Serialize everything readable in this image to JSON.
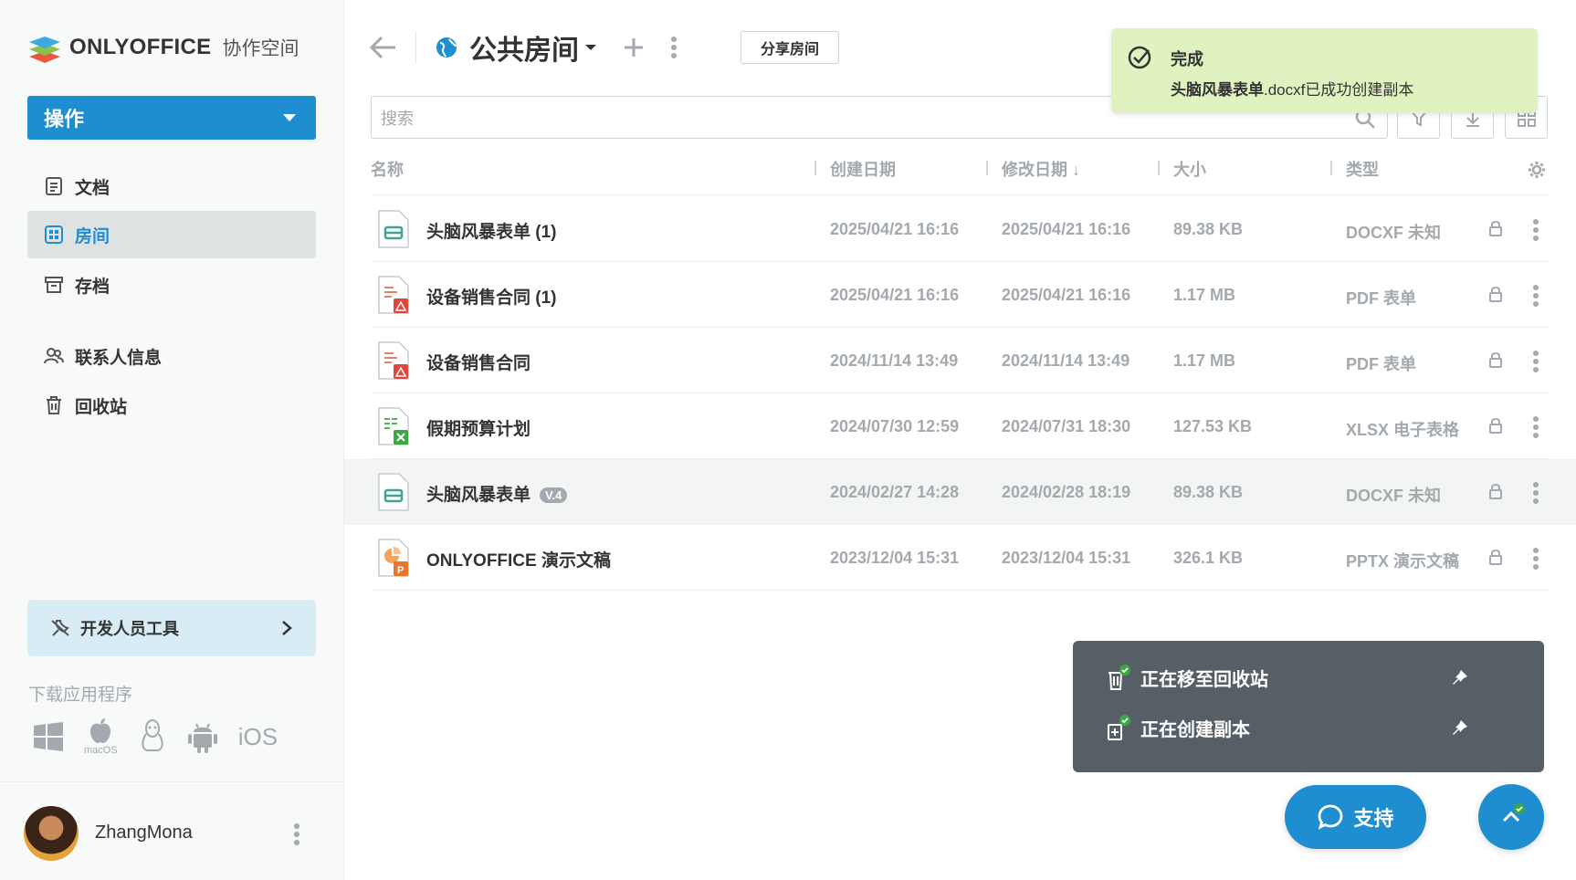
{
  "sidebar": {
    "logo_text": "ONLYOFFICE",
    "logo_sub": "协作空间",
    "action_label": "操作",
    "nav": [
      {
        "label": "文档",
        "icon": "document-icon"
      },
      {
        "label": "房间",
        "icon": "rooms-icon",
        "active": true
      },
      {
        "label": "存档",
        "icon": "archive-icon"
      },
      {
        "label": "联系人信息",
        "icon": "contacts-icon"
      },
      {
        "label": "回收站",
        "icon": "trash-icon"
      }
    ],
    "dev_tools_label": "开发人员工具",
    "download_label": "下载应用程序",
    "apps": [
      "windows-icon",
      "macos-icon",
      "linux-icon",
      "android-icon",
      "ios-icon"
    ],
    "apps_macos_caption": "macOS",
    "apps_ios_label": "iOS",
    "username": "ZhangMona"
  },
  "header": {
    "room_title": "公共房间",
    "share_label": "分享房间",
    "search_placeholder": "搜索"
  },
  "table": {
    "columns": [
      "名称",
      "创建日期",
      "修改日期",
      "大小",
      "类型"
    ],
    "sort_arrow": "↓",
    "rows": [
      {
        "name": "头脑风暴表单 (1)",
        "created": "2025/04/21 16:16",
        "modified": "2025/04/21 16:16",
        "size": "89.38 KB",
        "type": "DOCXF 未知",
        "icon": "docxf-icon"
      },
      {
        "name": "设备销售合同 (1)",
        "created": "2025/04/21 16:16",
        "modified": "2025/04/21 16:16",
        "size": "1.17 MB",
        "type": "PDF 表单",
        "icon": "pdf-icon"
      },
      {
        "name": "设备销售合同",
        "created": "2024/11/14 13:49",
        "modified": "2024/11/14 13:49",
        "size": "1.17 MB",
        "type": "PDF 表单",
        "icon": "pdf-icon"
      },
      {
        "name": "假期预算计划",
        "created": "2024/07/30 12:59",
        "modified": "2024/07/31 18:30",
        "size": "127.53 KB",
        "type": "XLSX 电子表格",
        "icon": "xlsx-icon"
      },
      {
        "name": "头脑风暴表单",
        "version": "V.4",
        "created": "2024/02/27 14:28",
        "modified": "2024/02/28 18:19",
        "size": "89.38 KB",
        "type": "DOCXF 未知",
        "icon": "docxf-icon",
        "highlight": true
      },
      {
        "name": "ONLYOFFICE 演示文稿",
        "created": "2023/12/04 15:31",
        "modified": "2023/12/04 15:31",
        "size": "326.1 KB",
        "type": "PPTX 演示文稿",
        "icon": "pptx-icon"
      }
    ]
  },
  "toast": {
    "title": "完成",
    "filename": "头脑风暴表单",
    "message_rest": ".docxf已成功创建副本"
  },
  "operations": [
    {
      "label": "正在移至回收站",
      "icon": "trash-icon"
    },
    {
      "label": "正在创建副本",
      "icon": "copy-icon"
    }
  ],
  "support_label": "支持",
  "colors": {
    "accent": "#1e8ed1",
    "toast_bg": "#e1f2c1",
    "panel_bg": "#555f65",
    "muted": "#a3a9ae"
  }
}
